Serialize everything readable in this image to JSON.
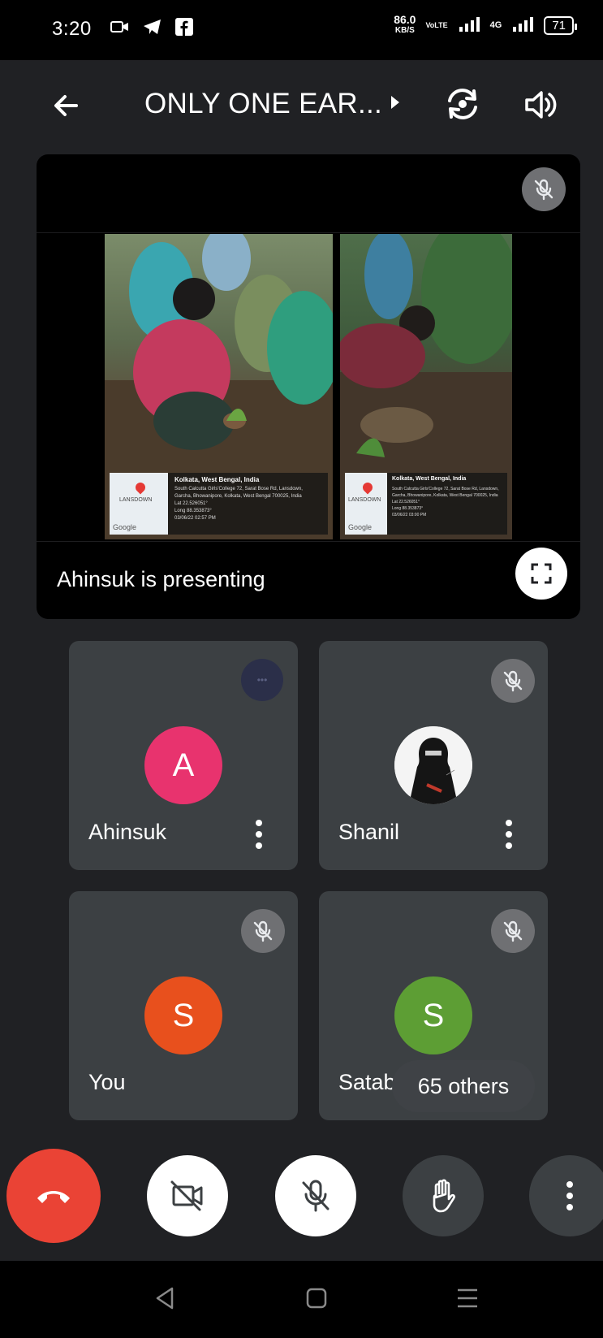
{
  "status_bar": {
    "time": "3:20",
    "net_speed": "86.0",
    "net_unit": "KB/S",
    "volte": "VoLTE",
    "network": "4G",
    "battery": "71",
    "left_icons": [
      "video-call-icon",
      "telegram-icon",
      "facebook-icon"
    ]
  },
  "header": {
    "title": "ONLY ONE EAR...",
    "back_icon": "arrow-left-icon",
    "switch_camera_icon": "flip-camera-icon",
    "audio_icon": "speaker-icon"
  },
  "presentation": {
    "label": "Ahinsuk is presenting",
    "mic_state": "muted",
    "shared_photos": [
      {
        "location_title": "Kolkata, West Bengal, India",
        "details": [
          "South Calcutta Girls'College 72, Sarat Bose Rd, Lansdown,",
          "Garcha, Bhowanipore, Kolkata, West Bengal 700025, India",
          "Lat 22.526051°",
          "Long 88.353873°",
          "03/06/22 02:57 PM"
        ],
        "map_label": "LANSDOWN",
        "map_brand": "Google"
      },
      {
        "location_title": "Kolkata, West Bengal, India",
        "details": [
          "South Calcutta Girls'College 72, Sarat Bose Rd, Lansdown,",
          "Garcha, Bhowanipore, Kolkata, West Bengal 700025, India",
          "Lat 22.526051°",
          "Long 88.353873°",
          "03/06/22 03:00 PM"
        ],
        "map_label": "LANSDOWN",
        "map_brand": "Google"
      }
    ]
  },
  "participants": [
    {
      "name": "Ahinsuk",
      "initial": "A",
      "avatar_color": "#e8336e",
      "mic": "speaking"
    },
    {
      "name": "Shanil",
      "initial": "",
      "avatar_color": "#ffffff",
      "mic": "muted"
    },
    {
      "name": "You",
      "initial": "S",
      "avatar_color": "#e8501d",
      "mic": "muted"
    },
    {
      "name": "Satabdi",
      "initial": "S",
      "avatar_color": "#5d9e34",
      "mic": "muted"
    }
  ],
  "others_chip": "65 others",
  "controls": {
    "end_call": "end-call-icon",
    "camera": "camera-off-icon",
    "mic": "mic-off-icon",
    "raise_hand": "raise-hand-icon",
    "more": "more-vertical-icon"
  },
  "colors": {
    "background": "#202124",
    "tile": "#3c4043",
    "end_call": "#ea4335",
    "muted_badge": "#6f7073"
  }
}
